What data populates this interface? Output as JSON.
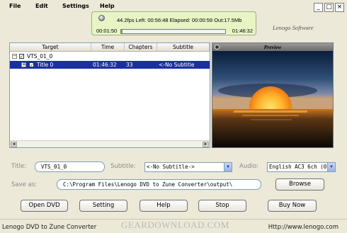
{
  "menu": {
    "items": [
      "File",
      "Edit",
      "Settings",
      "Help"
    ]
  },
  "window_controls": {
    "minimize": "_",
    "maximize": "□",
    "close": "×"
  },
  "status": {
    "line": "44.2fps Left: 00:56:48 Elapsed: 00:00:59 Out:17.5Mb",
    "time_left": "00:01:50",
    "time_right": "01:46:32",
    "progress_fraction": 0.015
  },
  "brand": "Lenogo Software",
  "table": {
    "headers": [
      "Target",
      "Time",
      "Chapters",
      "Subtitle"
    ],
    "rows": [
      {
        "toggle": "−",
        "target": "VTS_01_0",
        "time": "",
        "chapters": "",
        "subtitle": "",
        "selected": false
      },
      {
        "toggle": "+",
        "target": "Title 0",
        "time": "01:46:32",
        "chapters": "33",
        "subtitle": "<-No Subtitle",
        "selected": true
      }
    ],
    "scroll_left": "◄",
    "scroll_right": "►"
  },
  "preview": {
    "title": "Preview"
  },
  "form": {
    "title_label": "Title:",
    "title_value": "VTS_01_0",
    "subtitle_label": "Subtitle:",
    "subtitle_value": "<-No Subtitle->",
    "audio_label": "Audio:",
    "audio_value": "English AC3 6ch (0:",
    "saveas_label": "Save as:",
    "saveas_value": "C:\\Program Files\\Lenogo DVD to Zune Converter\\output\\",
    "browse_label": "Browse",
    "dropdown_glyph": "▼"
  },
  "buttons": {
    "open_dvd": "Open DVD",
    "setting": "Setting",
    "help": "Help",
    "stop": "Stop",
    "buy_now": "Buy Now"
  },
  "footer": {
    "app_name": "Lenogo DVD to Zune Converter",
    "watermark": "GEARDOWNLOAD.COM",
    "url": "Http://www.lenogo.com"
  },
  "colors": {
    "status_bg": "#e7f5c5",
    "progress": "#7cab3a",
    "selection": "#1a2fa6"
  }
}
